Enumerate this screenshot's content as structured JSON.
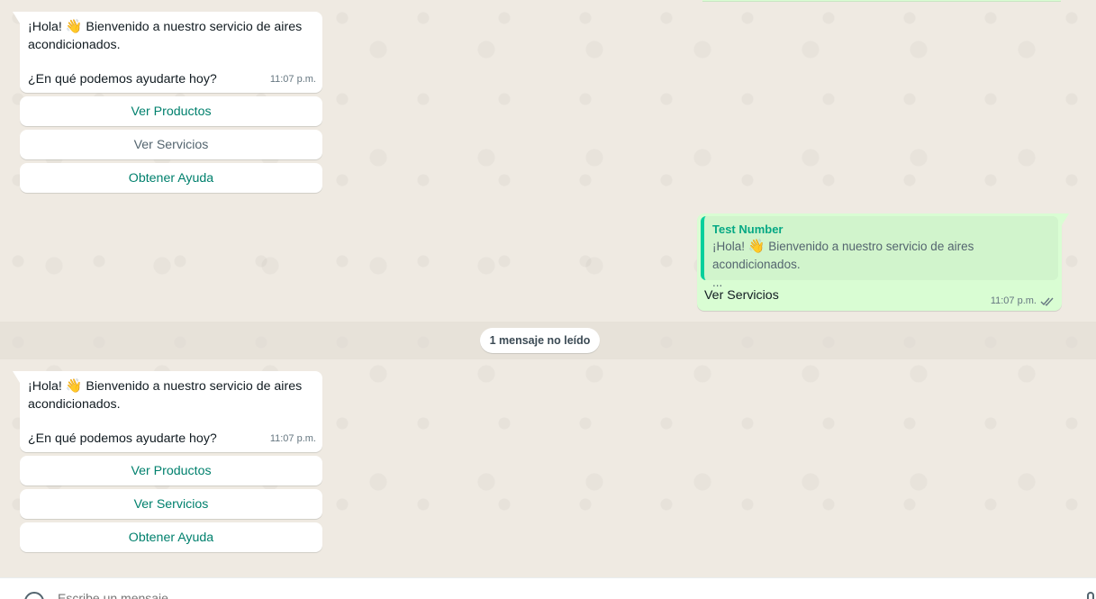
{
  "header_sliver": true,
  "messages_in": [
    {
      "line1": "¡Hola! ",
      "wave": "👋",
      "line1b": " Bienvenido a nuestro servicio de aires acondicionados.",
      "line2": "¿En qué podemos ayudarte hoy?",
      "time": "11:07 p.m.",
      "buttons": [
        "Ver Productos",
        "Ver Servicios",
        "Obtener Ayuda"
      ]
    },
    {
      "line1": "¡Hola! ",
      "wave": "👋",
      "line1b": " Bienvenido a nuestro servicio de aires acondicionados.",
      "line2": "¿En qué podemos ayudarte hoy?",
      "time": "11:07 p.m.",
      "buttons": [
        "Ver Productos",
        "Ver Servicios",
        "Obtener Ayuda"
      ]
    }
  ],
  "message_out": {
    "quote_author": "Test Number",
    "quote_text": "¡Hola! ",
    "quote_wave": "👋",
    "quote_text_b": " Bienvenido a nuestro servicio de aires acondicionados.",
    "quote_ellipsis": "...",
    "text": "Ver Servicios",
    "time": "11:07 p.m.",
    "status_icon": "double-check-icon"
  },
  "unread_divider": "1 mensaje no leído",
  "composer": {
    "placeholder": "Escribe un mensaje",
    "emoji_icon": "emoji-icon",
    "mic_icon": "mic-icon"
  },
  "colors": {
    "chat_bg": "#efeae2",
    "incoming_bubble": "#ffffff",
    "outgoing_bubble": "#d9fdd3",
    "button_text": "#00806d",
    "quote_accent": "#06cf9c"
  }
}
